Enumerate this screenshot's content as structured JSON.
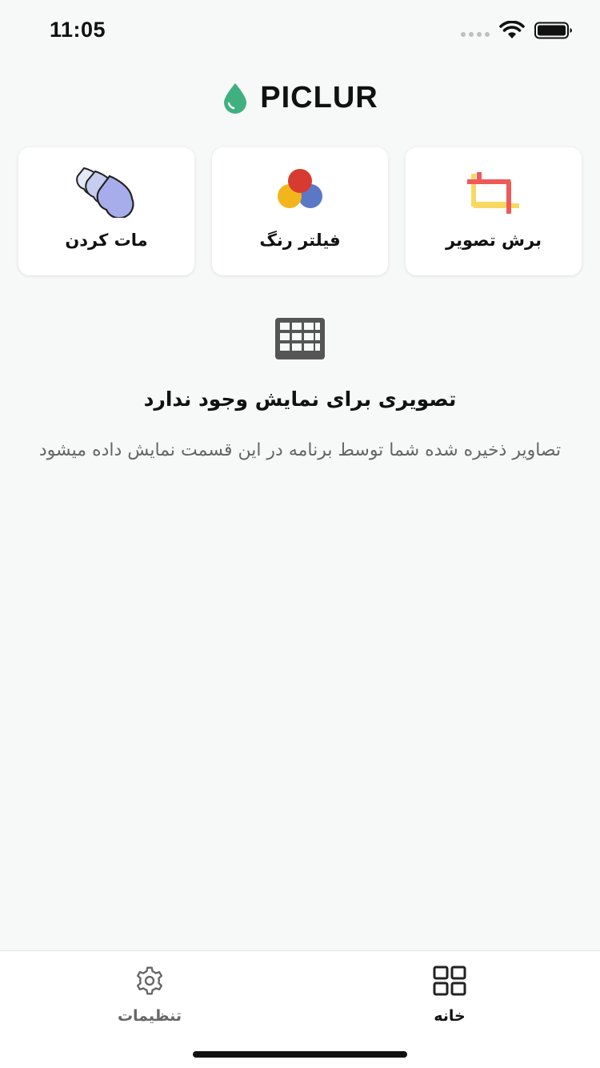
{
  "status_bar": {
    "time": "11:05"
  },
  "header": {
    "title": "PICLUR",
    "accent": "#3fb07f"
  },
  "tools": [
    {
      "id": "crop",
      "label": "برش تصویر",
      "icon": "crop-icon"
    },
    {
      "id": "filter",
      "label": "فیلتر رنگ",
      "icon": "color-filter-icon"
    },
    {
      "id": "blur",
      "label": "مات کردن",
      "icon": "blur-drops-icon"
    }
  ],
  "empty_state": {
    "icon": "grid-icon",
    "title": "تصویری برای نمایش وجود ندارد",
    "description": "تصاویر ذخیره شده شما توسط برنامه در این قسمت نمایش داده میشود"
  },
  "bottom_nav": {
    "home_label": "خانه",
    "settings_label": "تنظیمات"
  }
}
